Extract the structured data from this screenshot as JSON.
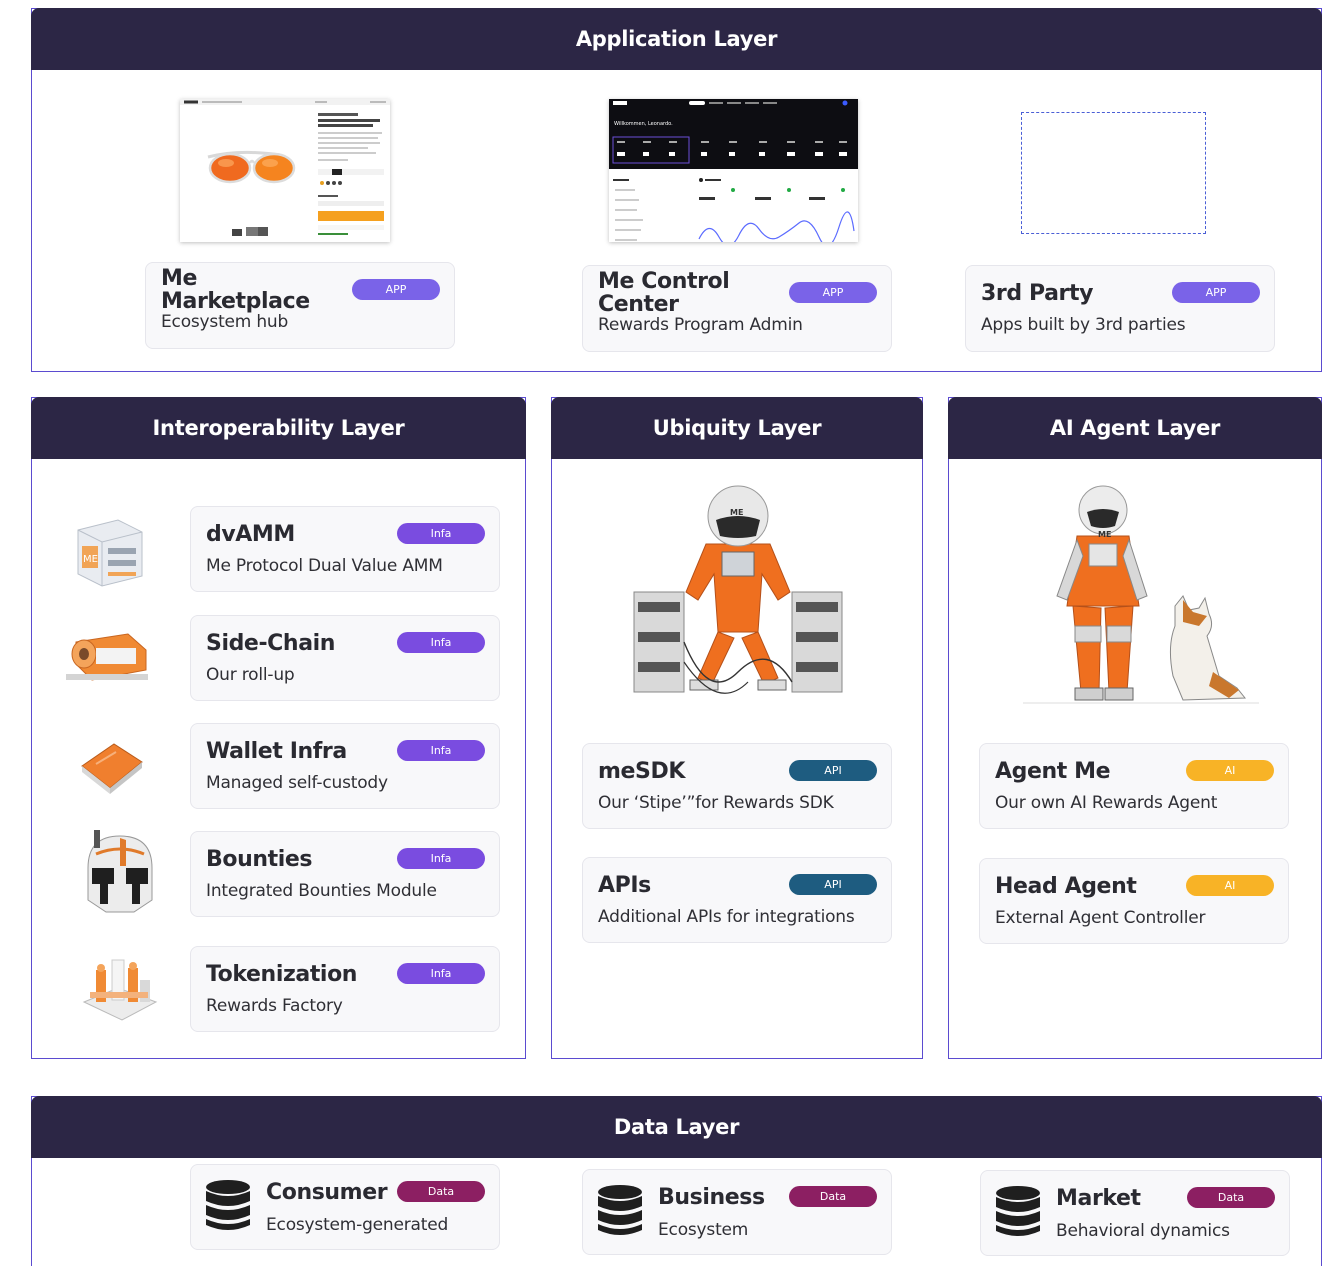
{
  "layers": {
    "application": {
      "title": "Application Layer",
      "cards": [
        {
          "title": "Me Marketplace",
          "subtitle": "Ecosystem hub",
          "badge": "APP"
        },
        {
          "title": "Me Control Center",
          "subtitle": "Rewards Program Admin",
          "badge": "APP"
        },
        {
          "title": "3rd Party",
          "subtitle": "Apps built by 3rd parties",
          "badge": "APP"
        }
      ],
      "dashboard_greeting": "Willkommen, Leonardo."
    },
    "interoperability": {
      "title": "Interoperability Layer",
      "cards": [
        {
          "title": "dvAMM",
          "subtitle": "Me Protocol Dual Value AMM",
          "badge": "Infa"
        },
        {
          "title": "Side-Chain",
          "subtitle": "Our roll-up",
          "badge": "Infa"
        },
        {
          "title": "Wallet Infra",
          "subtitle": "Managed self-custody",
          "badge": "Infa"
        },
        {
          "title": "Bounties",
          "subtitle": "Integrated Bounties Module",
          "badge": "Infa"
        },
        {
          "title": "Tokenization",
          "subtitle": "Rewards Factory",
          "badge": "Infa"
        }
      ]
    },
    "ubiquity": {
      "title": "Ubiquity Layer",
      "cards": [
        {
          "title": "meSDK",
          "subtitle": "Our ‘Stipe’”for Rewards SDK",
          "badge": "API"
        },
        {
          "title": "APIs",
          "subtitle": "Additional APIs for integrations",
          "badge": "API"
        }
      ],
      "helmet_text": "ME"
    },
    "ai_agent": {
      "title": "AI Agent Layer",
      "cards": [
        {
          "title": "Agent Me",
          "subtitle": "Our own AI Rewards Agent",
          "badge": "AI"
        },
        {
          "title": "Head Agent",
          "subtitle": "External Agent Controller",
          "badge": "AI"
        }
      ],
      "helmet_text": "ME"
    },
    "data": {
      "title": "Data Layer",
      "cards": [
        {
          "title": "Consumer",
          "subtitle": "Ecosystem-generated",
          "badge": "Data"
        },
        {
          "title": "Business",
          "subtitle": "Ecosystem",
          "badge": "Data"
        },
        {
          "title": "Market",
          "subtitle": "Behavioral dynamics",
          "badge": "Data"
        }
      ]
    }
  },
  "colors": {
    "header_bg": "#2c2645",
    "border": "#5b4bd0",
    "badge_app": "#7a63e8",
    "badge_infra": "#7a4ce0",
    "badge_api": "#1e5c80",
    "badge_ai": "#f8b326",
    "badge_data": "#8c1f62"
  }
}
